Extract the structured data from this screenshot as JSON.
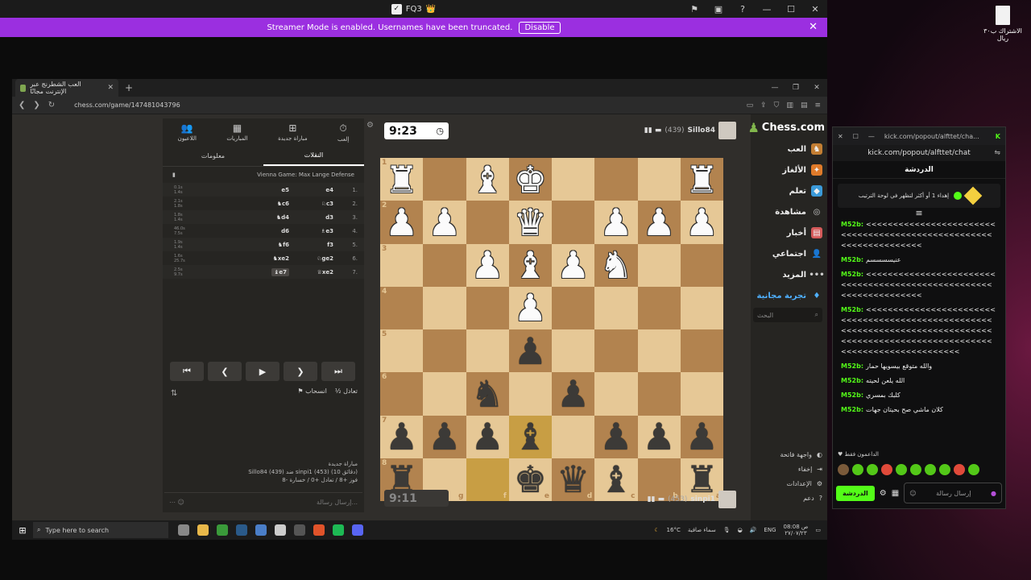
{
  "outer_window": {
    "title": "FQ3",
    "title_emoji": "👑",
    "streamer_bar": {
      "message": "Streamer Mode is enabled. Usernames have been truncated.",
      "disable_label": "Disable"
    }
  },
  "browser": {
    "tab_title": "العب الشطرنج عبر الإنترنت مجانًا",
    "url": "chess.com/game/147481043796"
  },
  "nav": {
    "logo": "Chess.com",
    "items": [
      "العب",
      "الألغاز",
      "تعلم",
      "مشاهدة",
      "أخبار",
      "اجتماعي",
      "المزيد",
      "تجربة مجانية"
    ],
    "search_placeholder": "البحث",
    "bottom": [
      "واجهة فاتحة",
      "إخفاء",
      "الإعدادات",
      "دعم"
    ]
  },
  "players": {
    "top": {
      "name": "Sillo84",
      "rating": "(439)",
      "clock": "9:23"
    },
    "bottom": {
      "name": "sinpi1",
      "rating": "(453)",
      "clock": "9:11"
    }
  },
  "board": {
    "orientation": "black-bottom",
    "rank_labels": [
      "1",
      "2",
      "3",
      "4",
      "5",
      "6",
      "7",
      "8"
    ],
    "file_labels": [
      "h",
      "g",
      "f",
      "e",
      "d",
      "c",
      "b",
      "a"
    ],
    "rows": [
      [
        "wR",
        "",
        "wB",
        "wK",
        "",
        "",
        "",
        "wR"
      ],
      [
        "wP",
        "wP",
        "",
        "wQ",
        "",
        "wP",
        "wP",
        "wP"
      ],
      [
        "",
        "",
        "wP",
        "wB",
        "wP",
        "wN",
        "",
        ""
      ],
      [
        "",
        "",
        "",
        "wP",
        "",
        "",
        "",
        ""
      ],
      [
        "",
        "",
        "",
        "bP",
        "",
        "",
        "",
        ""
      ],
      [
        "",
        "",
        "bN",
        "",
        "bP",
        "",
        "",
        ""
      ],
      [
        "bP",
        "bP",
        "bP",
        "bB",
        "",
        "bP",
        "bP",
        "bP"
      ],
      [
        "bR",
        "",
        "",
        "bK",
        "bQ",
        "bB",
        "",
        "bR"
      ]
    ],
    "highlight": [
      [
        6,
        3
      ],
      [
        7,
        2
      ]
    ]
  },
  "moves_panel": {
    "topnav": [
      "إلعب",
      "مباراة جديدة",
      "المباريات",
      "اللاعبون"
    ],
    "tabs": [
      "النقلات",
      "معلومات"
    ],
    "opening": "Vienna Game: Max Lange Defense",
    "moves": [
      {
        "n": "1.",
        "w": "e4",
        "b": "e5",
        "t1": "0.1s",
        "t2": "1.4s"
      },
      {
        "n": "2.",
        "w": "♘c3",
        "b": "♞c6",
        "t1": "2.1s",
        "t2": "1.8s"
      },
      {
        "n": "3.",
        "w": "d3",
        "b": "♞d4",
        "t1": "1.8s",
        "t2": "1.4s"
      },
      {
        "n": "4.",
        "w": "♗e3",
        "b": "d6",
        "t1": "46.0s",
        "t2": "7.5s"
      },
      {
        "n": "5.",
        "w": "f3",
        "b": "♞f6",
        "t1": "1.9s",
        "t2": "1.4s"
      },
      {
        "n": "6.",
        "w": "♘ge2",
        "b": "♞xe2",
        "t1": "1.6s",
        "t2": "25.7s"
      },
      {
        "n": "7.",
        "w": "♕xe2",
        "b": "♝e7",
        "t1": "2.5s",
        "t2": "9.7s"
      }
    ],
    "draw_label": "تعادل",
    "resign_label": "انسحاب",
    "game_info": [
      "مباراة جديدة",
      "Sillo84 (439) ضد sinpi1 (453) (10 دقائق)",
      "فوز +8 / تعادل +0 / خسارة -8"
    ],
    "message_placeholder": "إرسال رسالة..."
  },
  "taskbar": {
    "search_placeholder": "Type here to search",
    "weather": "16°C",
    "weather_desc": "سماء صافية",
    "lang": "ENG",
    "time": "08:08 ص",
    "date": "٢٧/٠٧/٢٣"
  },
  "desktop": {
    "file_label": "الاشتراك ب٣٠ ريال"
  },
  "chat": {
    "chrome_url": "kick.com/popout/alfttet/cha...",
    "addr": "kick.com/popout/alfttet/chat",
    "title": "الدردشة",
    "pinned": "إهداء 1 أو أكثر لتظهر في لوحة الترتيب",
    "messages": [
      {
        "user": "M52b:",
        "text": "<<<<<<<<<<<<<<<<<<<<<<<<<<<<<<<<<<<<<<<<<<<<<<<<<<<<<<<<<<<<<<<<<<<"
      },
      {
        "user": "M52b:",
        "text": "عنيسسسسم"
      },
      {
        "user": "M52b:",
        "text": "<<<<<<<<<<<<<<<<<<<<<<<<<<<<<<<<<<<<<<<<<<<<<<<<<<<<<<<<<<<<<<<<<<<"
      },
      {
        "user": "M52b:",
        "text": "<<<<<<<<<<<<<<<<<<<<<<<<<<<<<<<<<<<<<<<<<<<<<<<<<<<<<<<<<<<<<<<<<<<<<<<<<<<<<<<<<<<<<<<<<<<<<<<<<<<<<<<<<<<<<<<<<<<<<<<<<<<<<<<<<<"
      },
      {
        "user": "M52b:",
        "text": "والله متوقع بيسويها حمار"
      },
      {
        "user": "M52b:",
        "text": "الله يلعن لحيته"
      },
      {
        "user": "M52b:",
        "text": "كلبك بمسري"
      },
      {
        "user": "M52b:",
        "text": "كلان ماشي صح بحيتان جهات"
      }
    ],
    "supporters_label": "الداعمون فقط",
    "input_placeholder": "إرسال رسالة",
    "send_label": "الدردشة"
  }
}
